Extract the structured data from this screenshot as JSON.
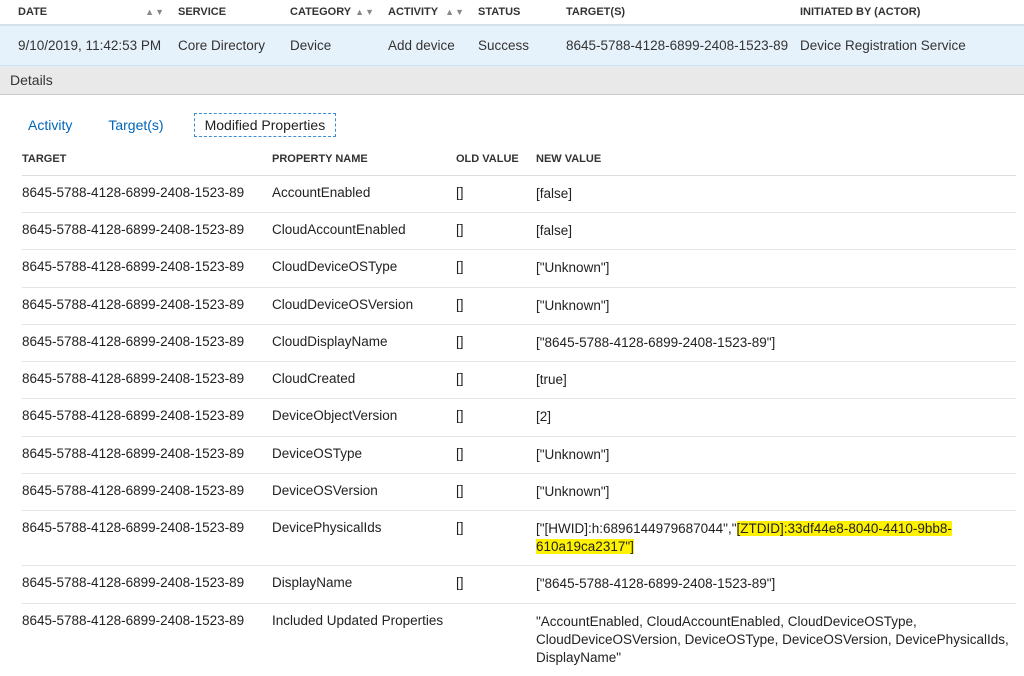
{
  "columns": {
    "date": "DATE",
    "service": "SERVICE",
    "category": "CATEGORY",
    "activity": "ACTIVITY",
    "status": "STATUS",
    "target": "TARGET(S)",
    "actor": "INITIATED BY (ACTOR)"
  },
  "row": {
    "date": "9/10/2019, 11:42:53 PM",
    "service": "Core Directory",
    "category": "Device",
    "activity": "Add device",
    "status": "Success",
    "target": "8645-5788-4128-6899-2408-1523-89",
    "actor": "Device Registration Service"
  },
  "details_label": "Details",
  "tabs": {
    "activity": "Activity",
    "targets": "Target(s)",
    "modified": "Modified Properties"
  },
  "prop_columns": {
    "target": "TARGET",
    "name": "PROPERTY NAME",
    "old": "OLD VALUE",
    "new": "NEW VALUE"
  },
  "target_id": "8645-5788-4128-6899-2408-1523-89",
  "props": [
    {
      "name": "AccountEnabled",
      "old": "[]",
      "new": "[false]"
    },
    {
      "name": "CloudAccountEnabled",
      "old": "[]",
      "new": "[false]"
    },
    {
      "name": "CloudDeviceOSType",
      "old": "[]",
      "new": "[\"Unknown\"]"
    },
    {
      "name": "CloudDeviceOSVersion",
      "old": "[]",
      "new": "[\"Unknown\"]"
    },
    {
      "name": "CloudDisplayName",
      "old": "[]",
      "new": "[\"8645-5788-4128-6899-2408-1523-89\"]"
    },
    {
      "name": "CloudCreated",
      "old": "[]",
      "new": "[true]"
    },
    {
      "name": "DeviceObjectVersion",
      "old": "[]",
      "new": "[2]"
    },
    {
      "name": "DeviceOSType",
      "old": "[]",
      "new": "[\"Unknown\"]"
    },
    {
      "name": "DeviceOSVersion",
      "old": "[]",
      "new": "[\"Unknown\"]"
    },
    {
      "name": "DevicePhysicalIds",
      "old": "[]",
      "new_prefix": "[\"[HWID]:h:6896144979687044\",\"",
      "new_highlight": "[ZTDID]:33df44e8-8040-4410-9bb8-610a19ca2317\"]"
    },
    {
      "name": "DisplayName",
      "old": "[]",
      "new": "[\"8645-5788-4128-6899-2408-1523-89\"]"
    },
    {
      "name": "Included Updated Properties",
      "old": "",
      "new": "\"AccountEnabled, CloudAccountEnabled, CloudDeviceOSType, CloudDeviceOSVersion, DeviceOSType, DeviceOSVersion, DevicePhysicalIds, DisplayName\""
    }
  ]
}
